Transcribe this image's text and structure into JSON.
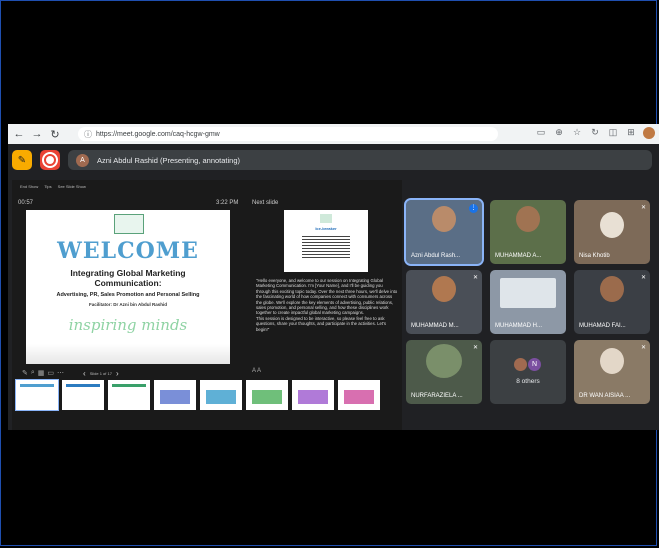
{
  "browser": {
    "url": "https://meet.google.com/caq-hcgw-gmw"
  },
  "meet": {
    "presenter_initial": "A",
    "presenter_status": "Azni Abdul Rashid (Presenting, annotating)"
  },
  "presenter_view": {
    "toolbar": [
      "End Show",
      "Tips",
      "See Slide Show"
    ],
    "timer": "00:57",
    "clock": "3:22 PM",
    "next_slide_label": "Next slide",
    "next_slide_title": "Ice-breaker",
    "speaker_notes": "\"Hello everyone, and welcome to our session on Integrating Global Marketing Communication. I'm [Your Name], and I'll be guiding you through this exciting topic today. Over the next three hours, we'll delve into the fascinating world of how companies connect with consumers across the globe. We'll explore the key elements of advertising, public relations, sales promotion, and personal selling, and how these disciplines work together to create impactful global marketing campaigns.\nThis session is designed to be interactive, so please feel free to ask questions, share your thoughts, and participate in the activities. Let's begin!\"",
    "slide": {
      "title": "WELCOME",
      "subtitle_line1": "Integrating Global Marketing",
      "subtitle_line2": "Communication:",
      "topics": "Advertising, PR, Sales Promotion and Personal Selling",
      "facilitator": "Facilitator: Dr Azni bin Abdul Rashid",
      "tagline": "inspiring minds"
    },
    "slide_counter": "Slide 1 of 17"
  },
  "participants": [
    {
      "name": "Azni Abdul Rash...",
      "active": true
    },
    {
      "name": "MUHAMMAD A...",
      "active": false
    },
    {
      "name": "Nisa Khotib",
      "active": false
    },
    {
      "name": "MUHAMMAD M...",
      "active": false
    },
    {
      "name": "MUHAMMAD H...",
      "active": false
    },
    {
      "name": "MUHAMAD FAI...",
      "active": false
    },
    {
      "name": "NURFARAZIELA ...",
      "active": false
    },
    {
      "name": "DR WAN AISIAA ...",
      "active": false
    }
  ],
  "others": {
    "initial": "N",
    "label": "8 others"
  },
  "colors": {
    "meet_bg": "#202124",
    "accent_blue": "#8ab4f8",
    "annotate_yellow": "#f9ab00",
    "record_red": "#ea4335"
  }
}
